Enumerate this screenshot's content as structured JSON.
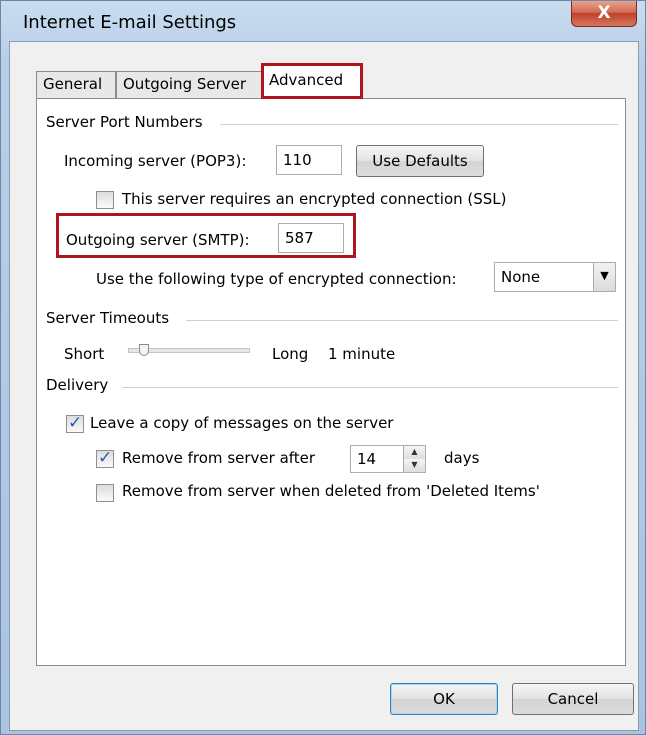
{
  "window": {
    "title": "Internet E-mail Settings",
    "close_glyph": "X"
  },
  "tabs": [
    {
      "label": "General",
      "active": false
    },
    {
      "label": "Outgoing Server",
      "active": false
    },
    {
      "label": "Advanced",
      "active": true
    }
  ],
  "server_ports": {
    "group_title": "Server Port Numbers",
    "incoming_label": "Incoming server (POP3):",
    "incoming_value": "110",
    "use_defaults_label": "Use Defaults",
    "ssl_checkbox_label": "This server requires an encrypted connection (SSL)",
    "ssl_checked": false,
    "outgoing_label": "Outgoing server (SMTP):",
    "outgoing_value": "587",
    "encryption_label": "Use the following type of encrypted connection:",
    "encryption_value": "None"
  },
  "timeouts": {
    "group_title": "Server Timeouts",
    "short_label": "Short",
    "long_label": "Long",
    "value_label": "1 minute",
    "slider_level": 0.1
  },
  "delivery": {
    "group_title": "Delivery",
    "leave_copy_label": "Leave a copy of messages on the server",
    "leave_copy_checked": true,
    "remove_after_label": "Remove from server after",
    "remove_after_checked": true,
    "remove_after_days": "14",
    "days_label": "days",
    "remove_deleted_label": "Remove from server when deleted from 'Deleted Items'",
    "remove_deleted_checked": false
  },
  "footer": {
    "ok_label": "OK",
    "cancel_label": "Cancel"
  },
  "colors": {
    "highlight": "#b0141f",
    "check": "#2a5ea8"
  }
}
